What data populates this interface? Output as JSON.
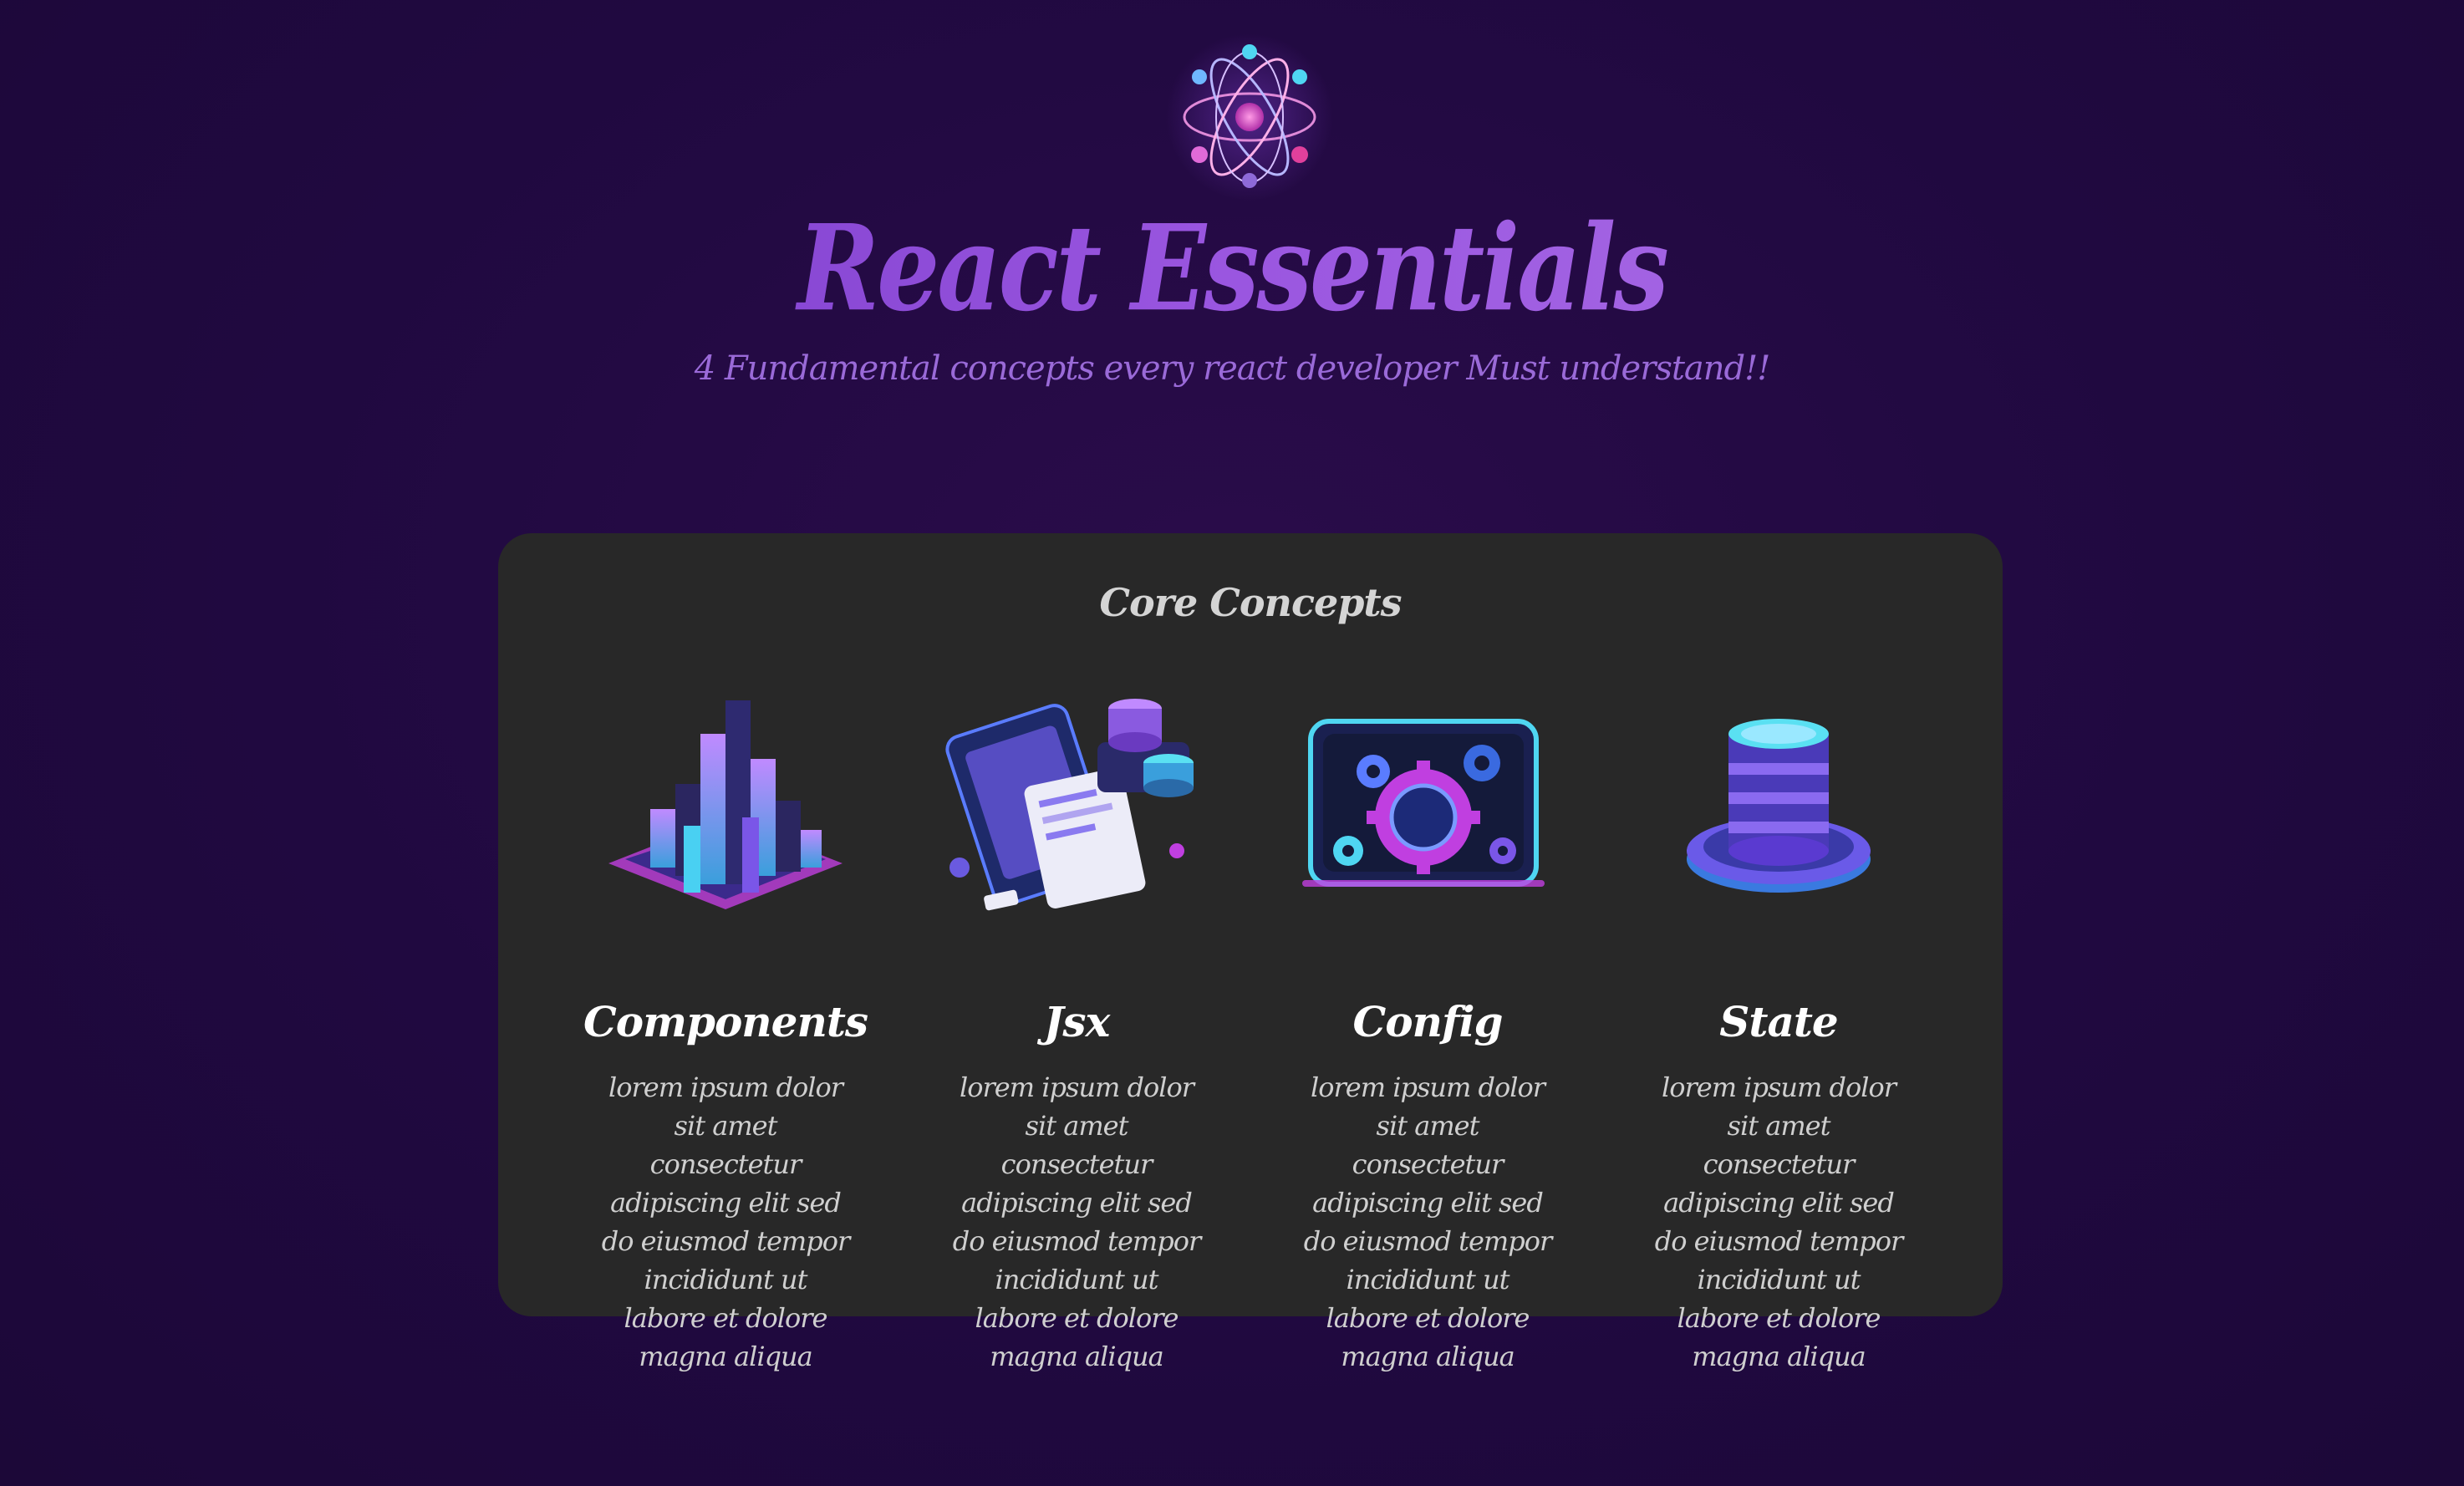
{
  "header": {
    "title": "React Essentials",
    "subtitle": "4 Fundamental concepts every react developer Must understand!!",
    "logo_icon": "react-atom-icon"
  },
  "core": {
    "heading": "Core Concepts",
    "cards": [
      {
        "title": "Components",
        "icon": "component-blocks-icon",
        "description": "lorem ipsum dolor sit amet consectetur adipiscing elit sed do eiusmod tempor incididunt ut labore et dolore magna aliqua"
      },
      {
        "title": "Jsx",
        "icon": "jsx-document-icon",
        "description": "lorem ipsum dolor sit amet consectetur adipiscing elit sed do eiusmod tempor incididunt ut labore et dolore magna aliqua"
      },
      {
        "title": "Config",
        "icon": "config-gears-icon",
        "description": "lorem ipsum dolor sit amet consectetur adipiscing elit sed do eiusmod tempor incididunt ut labore et dolore magna aliqua"
      },
      {
        "title": "State",
        "icon": "state-database-icon",
        "description": "lorem ipsum dolor sit amet consectetur adipiscing elit sed do eiusmod tempor incididunt ut labore et dolore magna aliqua"
      }
    ]
  },
  "colors": {
    "background": "#200940",
    "panel": "#282828",
    "title_accent": "#8e4fdc",
    "subtitle": "#9a6ad8",
    "neon_cyan": "#4fd6f2",
    "neon_magenta": "#c43fe0"
  }
}
